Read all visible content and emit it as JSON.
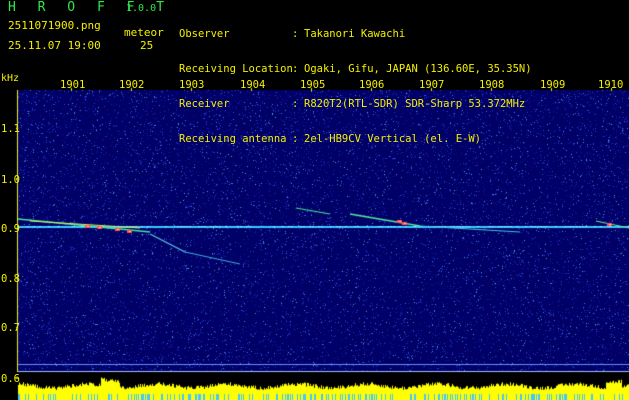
{
  "header": {
    "app_name": "H R O F F T",
    "version": "1.0.0",
    "file_name": "2511071900.png",
    "datetime": "25.11.07 19:00",
    "meteor_label": "meteor",
    "meteor_count": "25"
  },
  "info": [
    {
      "label": "Observer",
      "value": "Takanori Kawachi"
    },
    {
      "label": "Receiving Location",
      "value": "Ogaki, Gifu, JAPAN (136.60E, 35.35N)"
    },
    {
      "label": "Receiver",
      "value": "R820T2(RTL-SDR) SDR-Sharp 53.372MHz"
    },
    {
      "label": "Receiving antenna",
      "value": "2el-HB9CV Vertical (el. E-W)"
    }
  ],
  "spectrogram": {
    "y_unit": "kHz",
    "x_ticks": [
      "1901",
      "1902",
      "1903",
      "1904",
      "1905",
      "1906",
      "1907",
      "1908",
      "1909",
      "1910"
    ],
    "y_ticks": [
      "1.1",
      "1.0",
      "0.9",
      "0.8",
      "0.7",
      "0.6"
    ],
    "colors": {
      "label": "#f4f000",
      "brand": "#2ee84a",
      "carrier": "#38c8ff",
      "level_bar": "#ffff00"
    }
  }
}
